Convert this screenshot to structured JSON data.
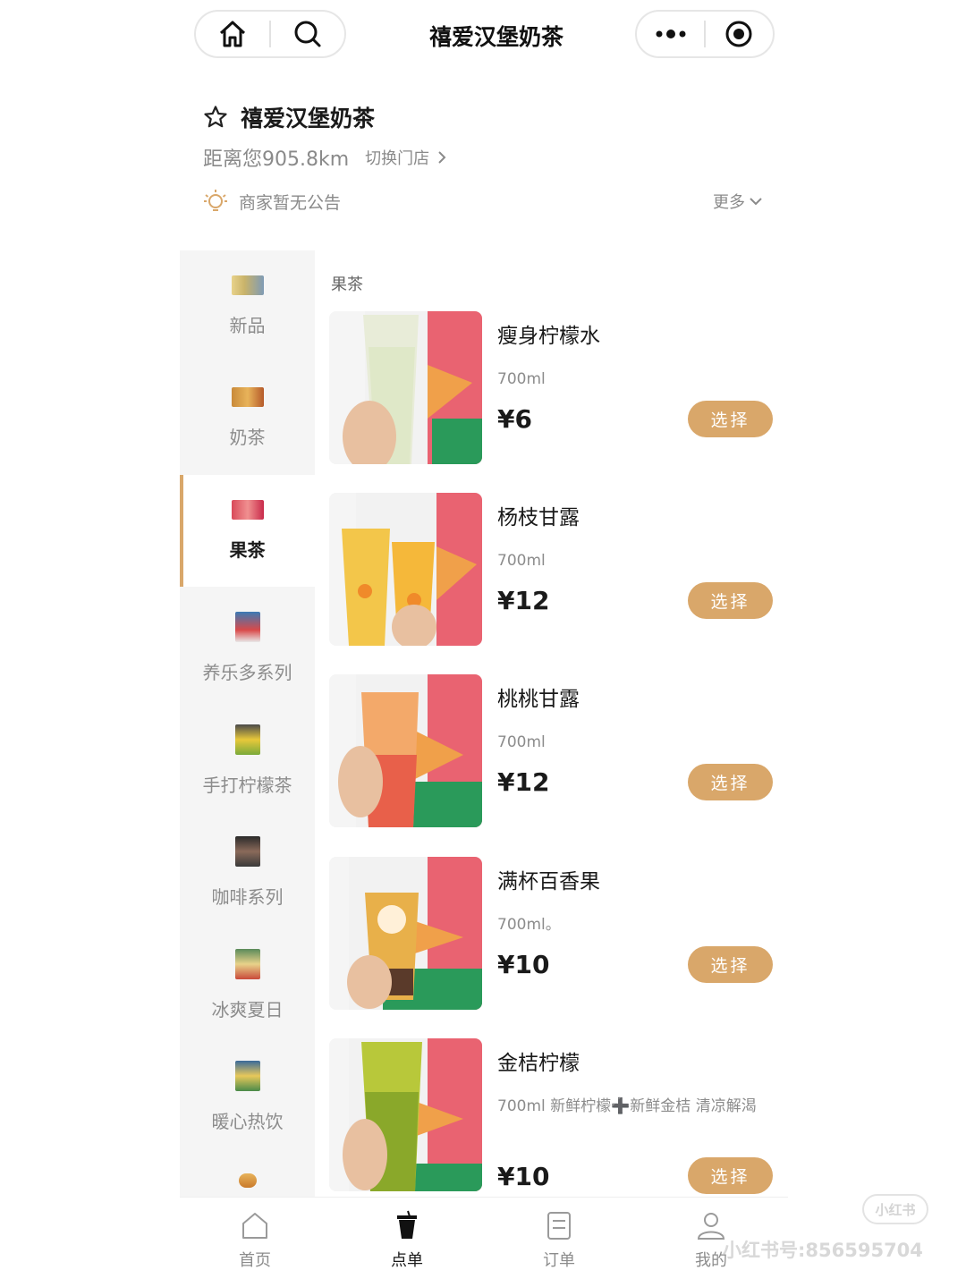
{
  "header": {
    "title": "禧爱汉堡奶茶"
  },
  "store": {
    "name": "禧爱汉堡奶茶",
    "distance": "距离您905.8km",
    "switch_label": "切换门店",
    "notice": "商家暂无公告",
    "more_label": "更多"
  },
  "sidebar": {
    "items": [
      {
        "label": "新品",
        "active": false
      },
      {
        "label": "奶茶",
        "active": false
      },
      {
        "label": "果茶",
        "active": true
      },
      {
        "label": "养乐多系列",
        "active": false
      },
      {
        "label": "手打柠檬茶",
        "active": false
      },
      {
        "label": "咖啡系列",
        "active": false
      },
      {
        "label": "冰爽夏日",
        "active": false
      },
      {
        "label": "暖心热饮",
        "active": false
      }
    ]
  },
  "list": {
    "heading": "果茶",
    "select_label": "选择",
    "products": [
      {
        "name": "瘦身柠檬水",
        "desc": "700ml",
        "price": "¥6"
      },
      {
        "name": "杨枝甘露",
        "desc": "700ml",
        "price": "¥12"
      },
      {
        "name": "桃桃甘露",
        "desc": "700ml",
        "price": "¥12"
      },
      {
        "name": "满杯百香果",
        "desc": "700ml。",
        "price": "¥10"
      },
      {
        "name": "金桔柠檬",
        "desc": "700ml 新鲜柠檬➕新鲜金桔 清凉解渴",
        "price": "¥10"
      }
    ]
  },
  "tabbar": {
    "tabs": [
      {
        "label": "首页",
        "icon": "home-icon",
        "active": false
      },
      {
        "label": "点单",
        "icon": "cup-icon",
        "active": true
      },
      {
        "label": "订单",
        "icon": "order-icon",
        "active": false
      },
      {
        "label": "我的",
        "icon": "user-icon",
        "active": false
      }
    ]
  },
  "watermark": {
    "logo": "小红书",
    "text": "小红书号:856595704"
  },
  "colors": {
    "accent": "#d9a76a",
    "sidebar_bg": "#f5f5f5"
  }
}
